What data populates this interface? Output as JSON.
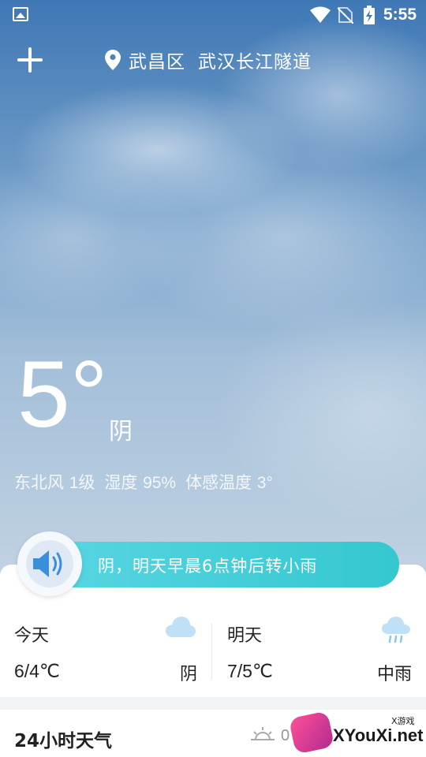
{
  "status_bar": {
    "time": "5:55",
    "icons": [
      "gallery-icon",
      "wifi-icon",
      "no-sim-icon",
      "battery-charging-icon"
    ]
  },
  "header": {
    "location_district": "武昌区",
    "location_place": "武汉长江隧道",
    "icons": [
      "add-icon",
      "location-pin-icon"
    ]
  },
  "current": {
    "temperature": "5°",
    "condition": "阴",
    "wind_label": "东北风",
    "wind_value": "1级",
    "humidity_label": "湿度",
    "humidity_value": "95%",
    "feels_like_label": "体感温度",
    "feels_like_value": "3°"
  },
  "banner": {
    "text": "阴，明天早晨6点钟后转小雨",
    "icon": "speaker-icon"
  },
  "forecast": [
    {
      "label": "今天",
      "range": "6/4℃",
      "condition": "阴",
      "icon": "cloud-icon"
    },
    {
      "label": "明天",
      "range": "7/5℃",
      "condition": "中雨",
      "icon": "rain-cloud-icon"
    }
  ],
  "hourly": {
    "title": "24小时天气",
    "sunrise_value": "0",
    "icon": "sunrise-icon"
  },
  "watermark": {
    "text": "XYouXi.net",
    "small": "X游戏"
  },
  "colors": {
    "sky_top": "#3f78b5",
    "banner": "#35c7cf",
    "card": "#ffffff"
  }
}
